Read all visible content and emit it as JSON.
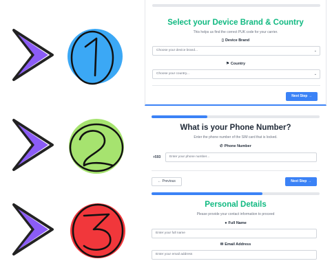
{
  "markers": [
    {
      "number": "1",
      "color": "#3ba8f5"
    },
    {
      "number": "2",
      "color": "#a6e36f"
    },
    {
      "number": "3",
      "color": "#f1373b"
    }
  ],
  "colors": {
    "arrow": "#8b5cf6",
    "accent": "#3b82f6",
    "heading_green": "#10b981"
  },
  "step1": {
    "title": "Select your Device Brand & Country",
    "subtitle": "This helps us find the correct PUK code for your carrier.",
    "brand_label": "Device Brand",
    "brand_placeholder": "Choose your device brand...",
    "country_label": "Country",
    "country_placeholder": "Choose your country...",
    "next_label": "Next Step →"
  },
  "step2": {
    "progress": 0.33,
    "title": "What is your Phone Number?",
    "subtitle": "Enter the phone number of the SIM card that is locked.",
    "phone_label": "Phone Number",
    "prefix": "+593",
    "phone_placeholder": "Enter your phone number...",
    "previous_label": "← Previous",
    "next_label": "Next Step →"
  },
  "step3": {
    "progress": 0.66,
    "title": "Personal Details",
    "subtitle": "Please provide your contact information to proceed",
    "name_label": "Full Name",
    "name_placeholder": "Enter your full name",
    "email_label": "Email Address",
    "email_placeholder": "Enter your email address"
  }
}
